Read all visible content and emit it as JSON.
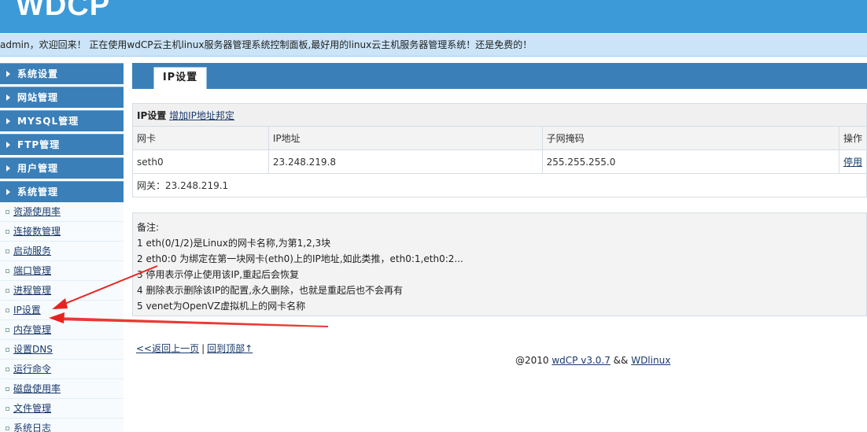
{
  "header": {
    "logo": "WDCP"
  },
  "welcome": {
    "text": "admin，欢迎回来！ 正在使用wdCP云主机linux服务器管理系统控制面板,最好用的linux云主机服务器管理系统！还是免费的！"
  },
  "sidebar": {
    "menus": [
      "系统设置",
      "网站管理",
      "MYSQL管理",
      "FTP管理",
      "用户管理",
      "系统管理"
    ],
    "subitems": [
      "资源使用率",
      "连接数管理",
      "启动服务",
      "端口管理",
      "进程管理",
      "IP设置",
      "内存管理",
      "设置DNS",
      "运行命令",
      "磁盘使用率",
      "文件管理",
      "系统日志"
    ]
  },
  "main": {
    "tab": "IP设置",
    "section_title": "IP设置",
    "add_link": "增加IP地址邦定",
    "columns": [
      "网卡",
      "IP地址",
      "子网掩码",
      "操作"
    ],
    "rows": [
      {
        "nic": "seth0",
        "ip": "23.248.219.8",
        "mask": "255.255.255.0",
        "action": "停用"
      }
    ],
    "gateway": "网关：23.248.219.1",
    "notes": [
      "备注:",
      "1 eth(0/1/2)是Linux的网卡名称,为第1,2,3块",
      "2 eth0:0 为绑定在第一块网卡(eth0)上的IP地址,如此类推，eth0:1,eth0:2...",
      "3 停用表示停止使用该IP,重起后会恢复",
      "4 删除表示删除该IP的配置,永久删除，也就是重起后也不会再有",
      "5 venet为OpenVZ虚拟机上的网卡名称"
    ],
    "back_link": "<<返回上一页",
    "separator": "|",
    "top_link": "回到顶部↑"
  },
  "footer": {
    "prefix": "@2010 ",
    "version_link": "wdCP v3.0.7",
    "mid": " && ",
    "brand_link": "WDlinux"
  },
  "colors": {
    "header": "#3d9ad8",
    "menu": "#3a7fb8",
    "arrow": "#e8231f"
  }
}
